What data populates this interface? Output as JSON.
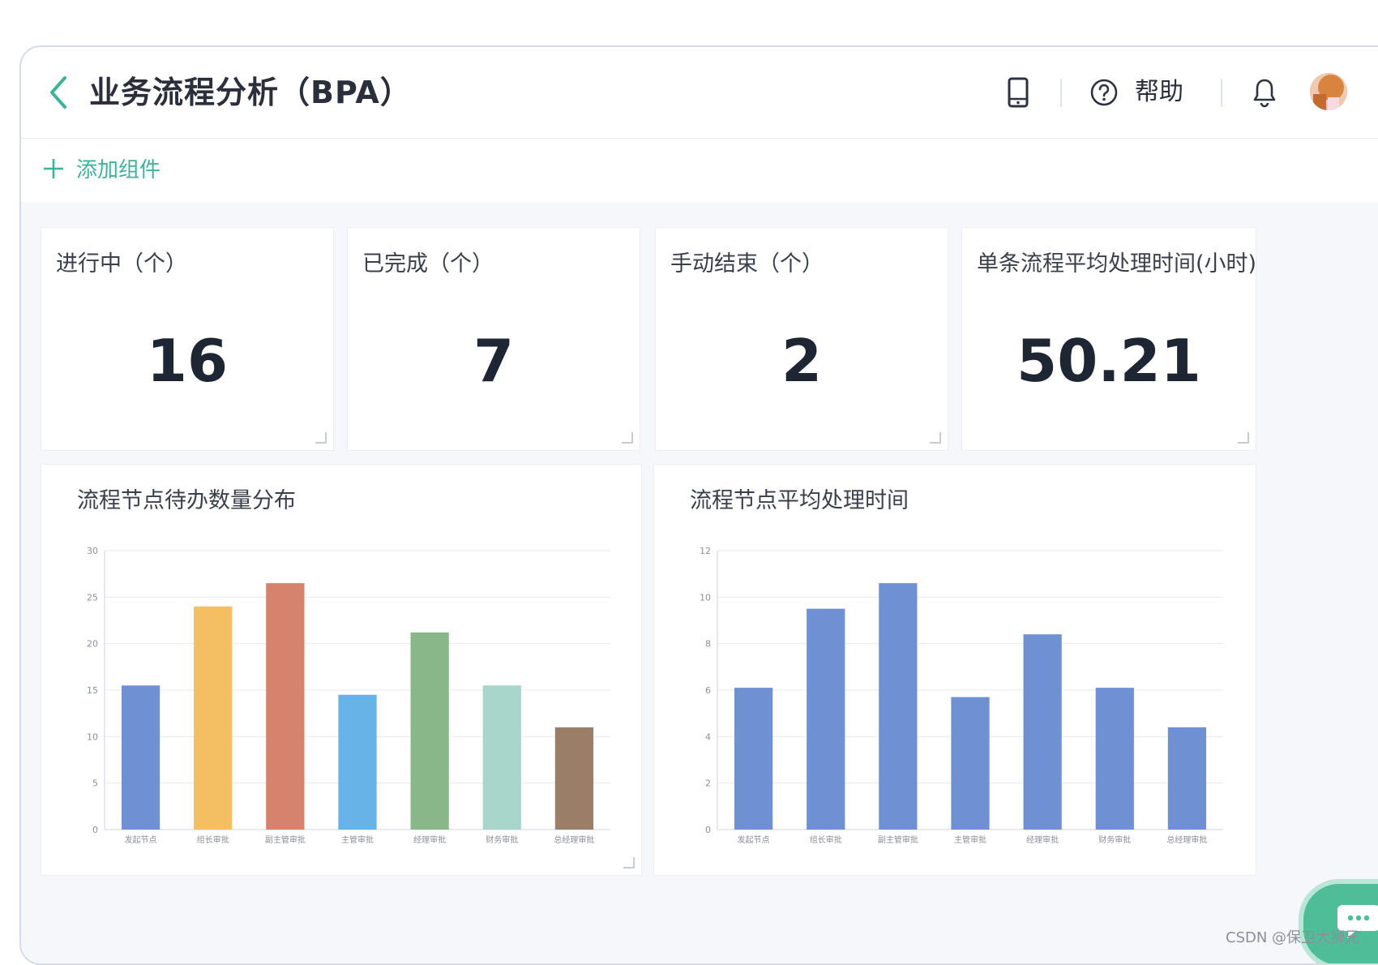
{
  "header": {
    "title": "业务流程分析（BPA）",
    "help_label": "帮助"
  },
  "toolbar": {
    "add_label": "添加组件"
  },
  "kpis": [
    {
      "label": "进行中（个）",
      "value": "16"
    },
    {
      "label": "已完成（个）",
      "value": "7"
    },
    {
      "label": "手动结束（个）",
      "value": "2"
    },
    {
      "label": "单条流程平均处理时间(小时)",
      "value": "50.21"
    }
  ],
  "icons": {
    "back": "chevron-left-icon",
    "device": "tablet-icon",
    "help": "question-circle-icon",
    "notification": "bell-icon",
    "chat": "chat-bubble-icon"
  },
  "colors": {
    "accent": "#3eb39c",
    "bar_blue": "#7090d4"
  },
  "chart_data": [
    {
      "type": "bar",
      "title": "流程节点待办数量分布",
      "categories": [
        "发起节点",
        "组长审批",
        "副主管审批",
        "主管审批",
        "经理审批",
        "财务审批",
        "总经理审批"
      ],
      "values": [
        15.5,
        24,
        26.5,
        14.5,
        21.2,
        15.5,
        11
      ],
      "colors": [
        "#7090d4",
        "#f4be62",
        "#d5836c",
        "#67b3e8",
        "#89b789",
        "#a9d6cb",
        "#9a7e68"
      ],
      "ylim": [
        0,
        30
      ],
      "yticks": [
        0,
        5,
        10,
        15,
        20,
        25,
        30
      ],
      "grid": true
    },
    {
      "type": "bar",
      "title": "流程节点平均处理时间",
      "categories": [
        "发起节点",
        "组长审批",
        "副主管审批",
        "主管审批",
        "经理审批",
        "财务审批",
        "总经理审批"
      ],
      "values": [
        6.1,
        9.5,
        10.6,
        5.7,
        8.4,
        6.1,
        4.4
      ],
      "colors": [
        "#7090d4",
        "#7090d4",
        "#7090d4",
        "#7090d4",
        "#7090d4",
        "#7090d4",
        "#7090d4"
      ],
      "ylim": [
        0,
        12
      ],
      "yticks": [
        0,
        2,
        4,
        6,
        8,
        10,
        12
      ],
      "grid": true
    }
  ],
  "watermark": "CSDN @保卫大狮兄"
}
